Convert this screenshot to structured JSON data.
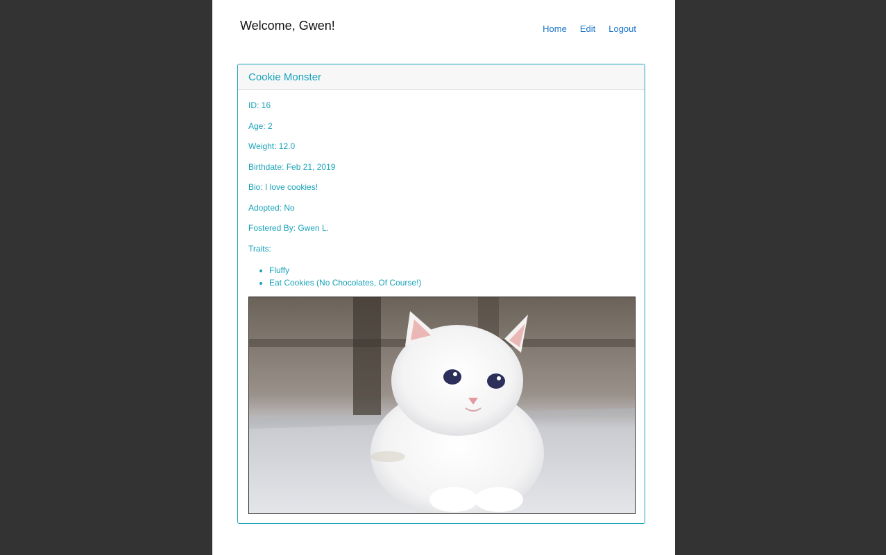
{
  "header": {
    "welcome": "Welcome, Gwen!",
    "nav": [
      "Home",
      "Edit",
      "Logout"
    ]
  },
  "pet": {
    "name": "Cookie Monster",
    "fields": [
      "ID: 16",
      "Age: 2",
      "Weight: 12.0",
      "Birthdate: Feb 21, 2019",
      "Bio: I love cookies!",
      "Adopted: No",
      "Fostered By: Gwen L.",
      "Traits:"
    ],
    "traits": [
      "Fluffy",
      "Eat Cookies (No Chocolates, Of Course!)"
    ]
  },
  "colors": {
    "background": "#333333",
    "accent": "#17a2b8",
    "link": "#1a73c8"
  },
  "icons": {
    "bullet": "disc"
  }
}
